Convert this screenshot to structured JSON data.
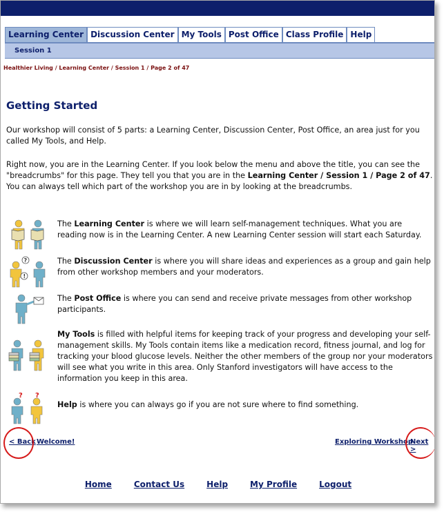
{
  "colors": {
    "navy": "#0d1f6b",
    "tab_active": "#9fb7d9",
    "subnav": "#b6c6e6",
    "crumb": "#7a1010",
    "annotation": "#d61a1a"
  },
  "tabs": [
    {
      "label": "Learning Center",
      "active": true
    },
    {
      "label": "Discussion Center",
      "active": false
    },
    {
      "label": "My Tools",
      "active": false
    },
    {
      "label": "Post Office",
      "active": false
    },
    {
      "label": "Class Profile",
      "active": false
    },
    {
      "label": "Help",
      "active": false
    }
  ],
  "subnav": {
    "label": "Session 1"
  },
  "breadcrumbs": [
    "Healthier Living",
    "Learning Center",
    "Session 1",
    "Page 2 of 47"
  ],
  "breadcrumb_sep": " / ",
  "page_title": "Getting Started",
  "intro": {
    "p1": "Our workshop will consist of 5 parts: a Learning Center, Discussion Center, Post Office, an area just for you called My Tools, and Help.",
    "p2_a": "Right now, you are in the Learning Center. If you look below the menu and above the title, you can see the \"breadcrumbs\" for this page. They tell you that you are in the ",
    "p2_bold": "Learning Center / Session 1 / Page 2 of 47",
    "p2_b": ". You can always tell which part of the workshop you are in by looking at the breadcrumbs."
  },
  "features": [
    {
      "icon": "reading-people-icon",
      "pre": "The ",
      "bold": "Learning Center",
      "post": " is where we will learn self-management techniques. What you are reading now is in the Learning Center. A new Learning Center session will start each Saturday."
    },
    {
      "icon": "discussion-people-icon",
      "pre": "The ",
      "bold": "Discussion Center",
      "post": " is where you will share ideas and experiences as a group and gain help from other workshop members and your moderators."
    },
    {
      "icon": "mail-person-icon",
      "pre": "The ",
      "bold": "Post Office",
      "post": " is where you can send and receive private messages from other workshop participants."
    },
    {
      "icon": "tools-people-icon",
      "pre": "",
      "bold": "My Tools",
      "post": " is filled with helpful items for keeping track of your progress and developing your self-management skills. My Tools contain items like a medication record, fitness journal, and log for tracking your blood glucose levels. Neither the other members of the group nor your moderators will see what you write in this area. Only Stanford investigators will have access to the information you keep in this area."
    },
    {
      "icon": "help-people-icon",
      "pre": "",
      "bold": "Help",
      "post": " is where you can always go if you are not sure where to find something."
    }
  ],
  "pager": {
    "back": "< Back",
    "prev_title": "Welcome!",
    "next_title": "Exploring Workshop",
    "next": "Next >"
  },
  "footer": [
    "Home",
    "Contact Us",
    "Help",
    "My Profile",
    "Logout"
  ]
}
